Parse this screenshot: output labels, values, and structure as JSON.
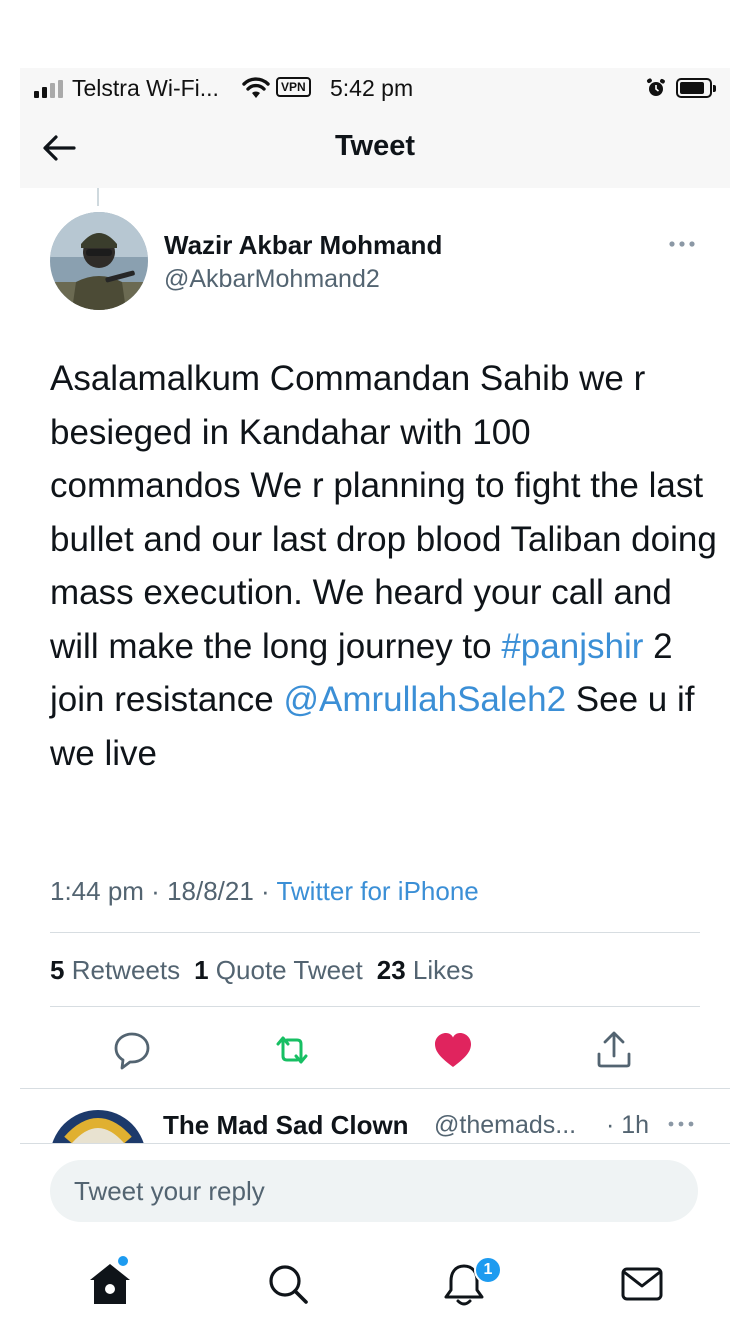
{
  "status_bar": {
    "carrier": "Telstra Wi-Fi...",
    "vpn": "VPN",
    "time": "5:42 pm"
  },
  "nav": {
    "title": "Tweet"
  },
  "tweet": {
    "author_name": "Wazir Akbar Mohmand",
    "author_handle": "@AkbarMohmand2",
    "text_before_hashtag": "Asalamalkum Commandan Sahib we r besieged in Kandahar with 100 commandos We r planning to fight the last bullet and our last drop blood Taliban doing mass execution. We heard your call and will make the long journey to ",
    "hashtag": "#panjshir",
    "text_mid": " 2 join resistance ",
    "mention": "@AmrullahSaleh2",
    "text_after": " See u if we live",
    "time": "1:44 pm",
    "date": "18/8/21",
    "separator": " · ",
    "source": "Twitter for iPhone"
  },
  "stats": {
    "retweets_count": "5",
    "retweets_label": "Retweets",
    "quotes_count": "1",
    "quotes_label": "Quote Tweet",
    "likes_count": "23",
    "likes_label": "Likes"
  },
  "reply_preview": {
    "name": "The Mad Sad Clown",
    "handle": "@themads...",
    "time": "· 1h"
  },
  "reply_input": {
    "placeholder": "Tweet your reply"
  },
  "tab_bar": {
    "notification_badge": "1"
  },
  "colors": {
    "link": "#3b8fd6",
    "like": "#e0245e",
    "retweet": "#17bf63",
    "secondary_text": "#536471"
  },
  "icons": [
    "signal-icon",
    "wifi-icon",
    "alarm-icon",
    "battery-icon",
    "back-arrow-icon",
    "more-icon",
    "reply-icon",
    "retweet-icon",
    "like-icon",
    "share-icon",
    "home-icon",
    "search-icon",
    "notifications-icon",
    "messages-icon"
  ]
}
